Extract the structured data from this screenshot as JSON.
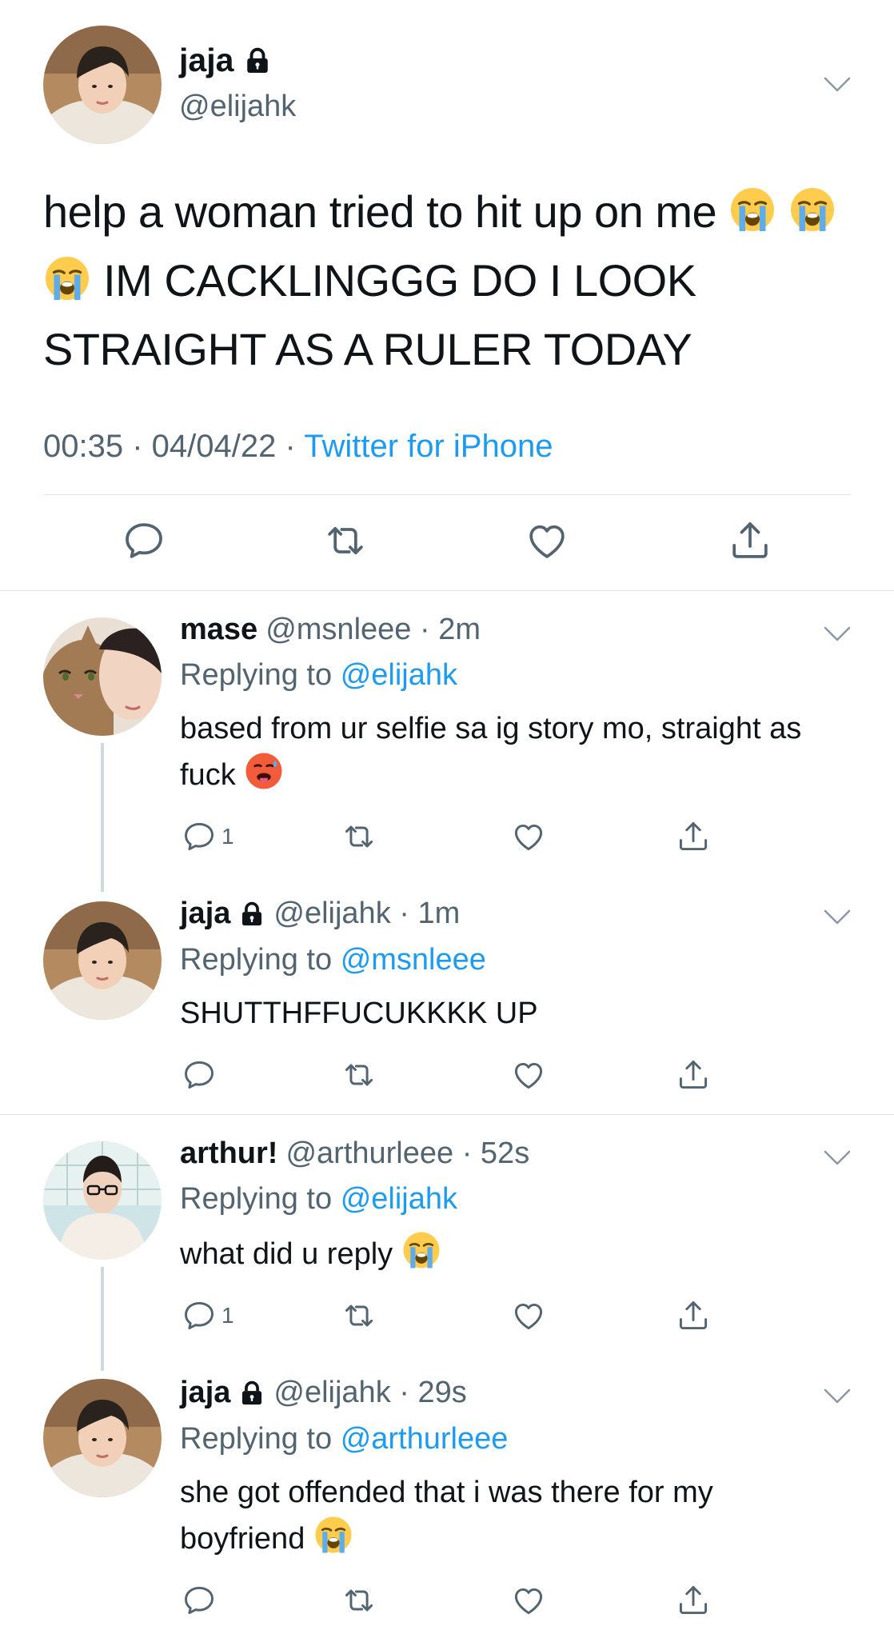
{
  "main_tweet": {
    "display_name": "jaja",
    "handle": "@elijahk",
    "text_part1": "help a woman tried to hit up on me",
    "text_part2": "IM CACKLINGGG DO I LOOK STRAIGHT AS A RULER TODAY",
    "time": "00:35",
    "date": "04/04/22",
    "source": "Twitter for iPhone",
    "icons": [
      "lock-icon",
      "chevron-down-icon",
      "reply-icon",
      "retweet-icon",
      "like-icon",
      "share-icon"
    ]
  },
  "replies": [
    {
      "display_name": "mase",
      "handle": "@msnleee",
      "time": "2m",
      "replying_label": "Replying to",
      "replying_to": "@elijahk",
      "text": "based from ur selfie sa ig story mo, straight as fuck",
      "reply_count": "1"
    },
    {
      "display_name": "jaja",
      "handle": "@elijahk",
      "time": "1m",
      "replying_label": "Replying to",
      "replying_to": "@msnleee",
      "text": "SHUTTHFFUCUKKKK UP",
      "reply_count": ""
    },
    {
      "display_name": "arthur!",
      "handle": "@arthurleee",
      "time": "52s",
      "replying_label": "Replying to",
      "replying_to": "@elijahk",
      "text": "what did u reply",
      "reply_count": "1"
    },
    {
      "display_name": "jaja",
      "handle": "@elijahk",
      "time": "29s",
      "replying_label": "Replying to",
      "replying_to": "@arthurleee",
      "text": "she got offended that i was there for my boyfriend",
      "reply_count": ""
    }
  ],
  "colors": {
    "link": "#1d9bf0",
    "muted": "#536471",
    "text": "#0f1419",
    "divider": "#dfe3e6",
    "thread_line": "#cfd9de"
  }
}
